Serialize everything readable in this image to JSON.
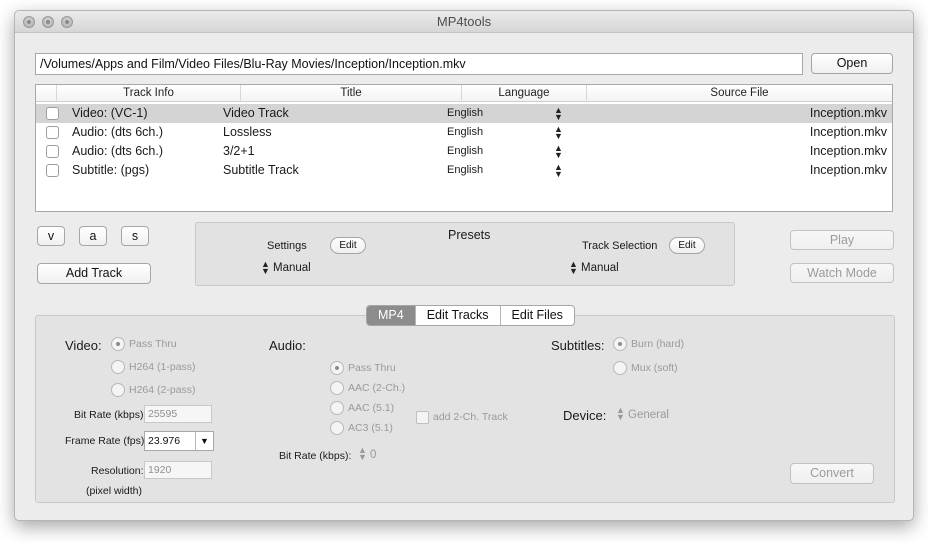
{
  "window": {
    "title": "MP4tools"
  },
  "file": {
    "path": "/Volumes/Apps and Film/Video Files/Blu-Ray Movies/Inception/Inception.mkv",
    "open_label": "Open"
  },
  "table": {
    "headers": [
      "Track Info",
      "Title",
      "Language",
      "Source File"
    ],
    "rows": [
      {
        "info": "Video: (VC-1)",
        "title": "Video Track",
        "language": "English",
        "source": "Inception.mkv",
        "selected": true
      },
      {
        "info": "Audio: (dts 6ch.)",
        "title": "Lossless",
        "language": "English",
        "source": "Inception.mkv",
        "selected": false
      },
      {
        "info": "Audio: (dts 6ch.)",
        "title": "3/2+1",
        "language": "English",
        "source": "Inception.mkv",
        "selected": false
      },
      {
        "info": "Subtitle: (pgs)",
        "title": "Subtitle Track",
        "language": "English",
        "source": "Inception.mkv",
        "selected": false
      }
    ]
  },
  "track_buttons": {
    "v": "v",
    "a": "a",
    "s": "s",
    "add_track": "Add Track"
  },
  "presets": {
    "title": "Presets",
    "settings_label": "Settings",
    "settings_edit": "Edit",
    "settings_value": "Manual",
    "track_selection_label": "Track Selection",
    "track_selection_edit": "Edit",
    "track_selection_value": "Manual"
  },
  "right_buttons": {
    "play": "Play",
    "watch_mode": "Watch Mode",
    "convert": "Convert"
  },
  "tabs": [
    {
      "label": "MP4",
      "active": true
    },
    {
      "label": "Edit Tracks",
      "active": false
    },
    {
      "label": "Edit Files",
      "active": false
    }
  ],
  "video": {
    "label": "Video:",
    "options": [
      "Pass Thru",
      "H264 (1-pass)",
      "H264 (2-pass)"
    ],
    "selected": "Pass Thru",
    "bitrate_label": "Bit Rate (kbps):",
    "bitrate_value": "25595",
    "framerate_label": "Frame Rate (fps):",
    "framerate_value": "23.976",
    "resolution_label": "Resolution:",
    "resolution_value": "1920",
    "resolution_note": "(pixel width)"
  },
  "audio": {
    "label": "Audio:",
    "options": [
      "Pass Thru",
      "AAC (2-Ch.)",
      "AAC (5.1)",
      "AC3 (5.1)"
    ],
    "selected": "Pass Thru",
    "add_track_label": "add 2-Ch. Track",
    "bitrate_label": "Bit Rate (kbps):",
    "bitrate_value": "0"
  },
  "subtitles": {
    "label": "Subtitles:",
    "options": [
      "Burn (hard)",
      "Mux (soft)"
    ],
    "selected": "Burn (hard)"
  },
  "device": {
    "label": "Device:",
    "value": "General"
  }
}
